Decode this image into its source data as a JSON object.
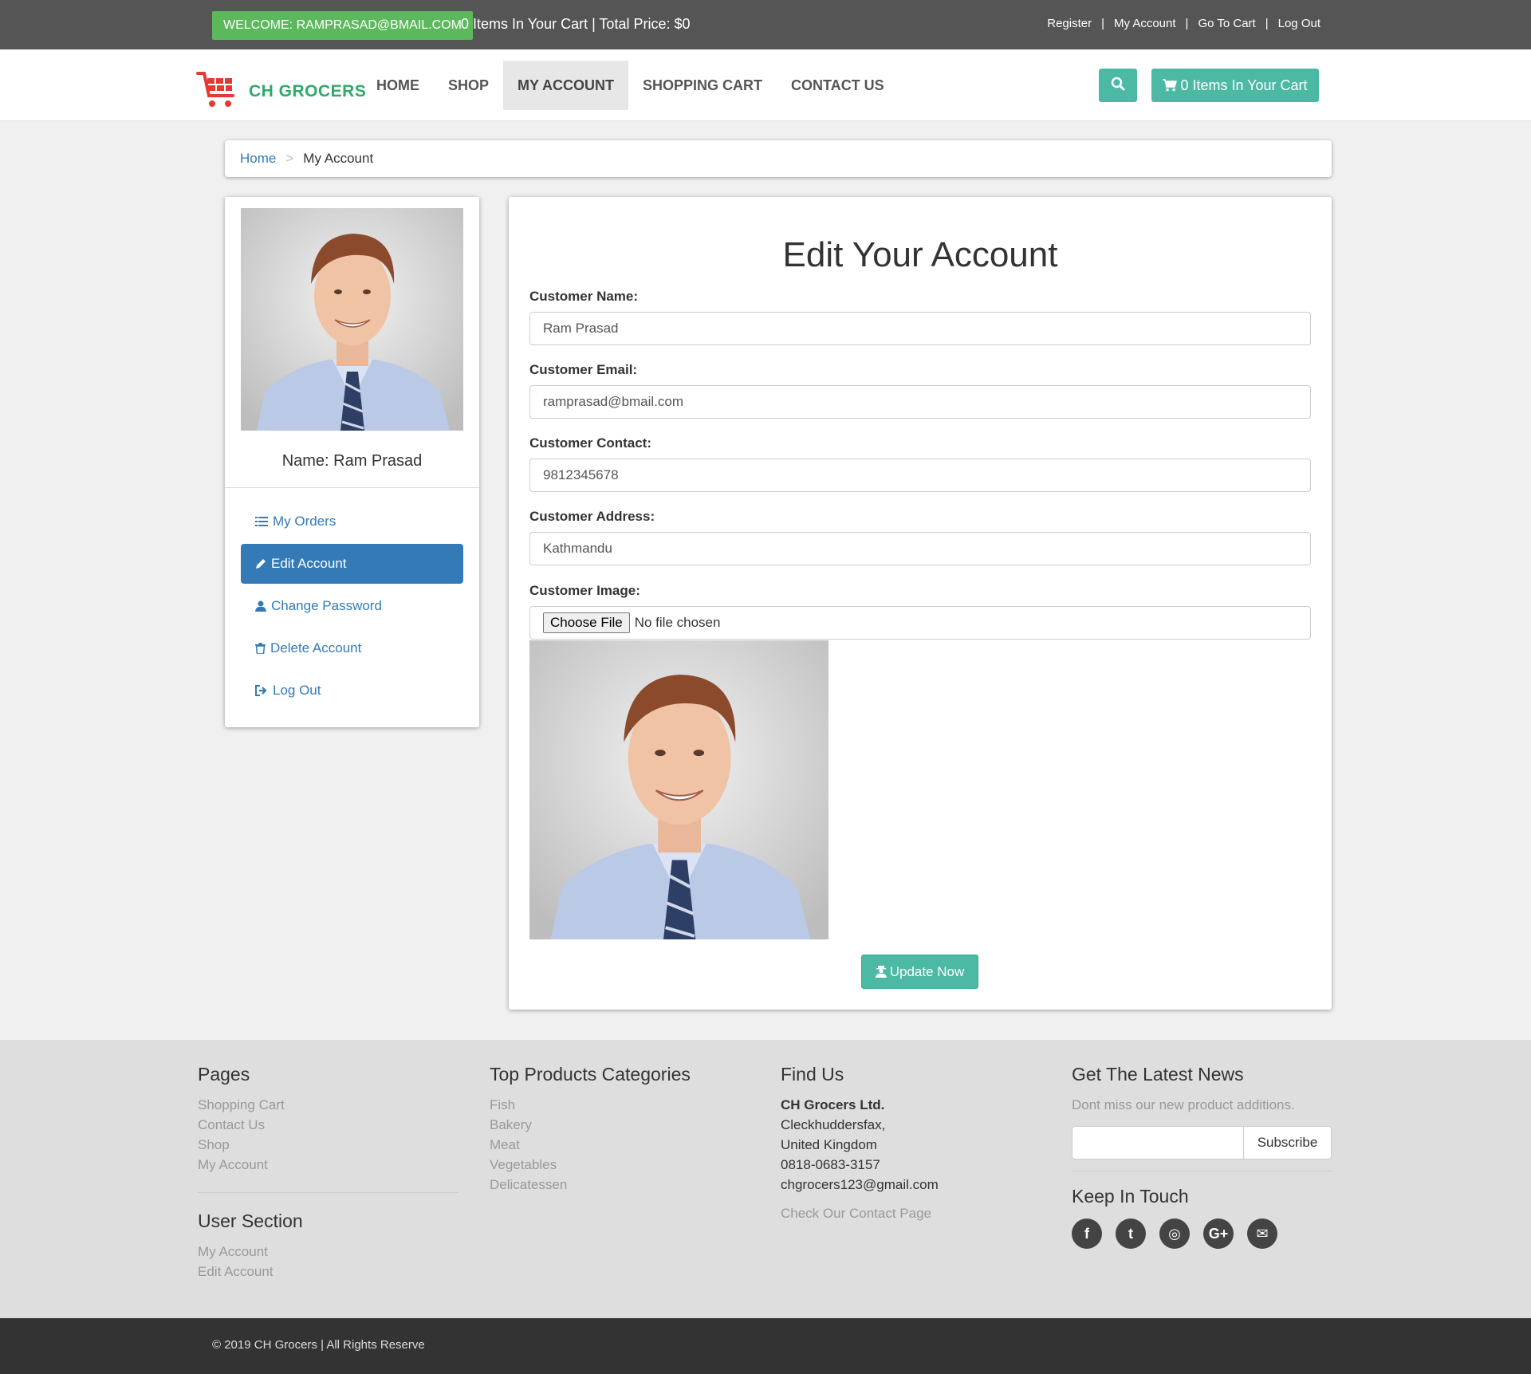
{
  "topbar": {
    "welcome": "WELCOME: RAMPRASAD@BMAIL.COM",
    "cart_info": "0 Items In Your Cart | Total Price: $0",
    "links": [
      "Register",
      "My Account",
      "Go To Cart",
      "Log Out"
    ],
    "separator": "|"
  },
  "brand": {
    "name": "CH GROCERS",
    "accent": "#2eaa6a",
    "cart_logo_color": "#e53935"
  },
  "nav": {
    "items": [
      "HOME",
      "SHOP",
      "MY ACCOUNT",
      "SHOPPING CART",
      "CONTACT US"
    ],
    "active": "MY ACCOUNT",
    "cart_button": "0 Items In Your Cart",
    "search_icon": "search-icon",
    "button_color": "#4cb9a5"
  },
  "breadcrumb": {
    "home": "Home",
    "separator": ">",
    "current": "My Account"
  },
  "sidebar": {
    "name": "Name: Ram Prasad",
    "menu": [
      {
        "label": "My Orders",
        "icon": "list-icon"
      },
      {
        "label": "Edit Account",
        "icon": "pencil-icon",
        "active": true
      },
      {
        "label": "Change Password",
        "icon": "user-icon"
      },
      {
        "label": "Delete Account",
        "icon": "trash-icon"
      },
      {
        "label": "Log Out",
        "icon": "sign-out-icon"
      }
    ],
    "active_color": "#337ab7"
  },
  "form": {
    "title": "Edit Your Account",
    "name_label": "Customer Name:",
    "name_value": "Ram Prasad",
    "email_label": "Customer Email:",
    "email_value": "ramprasad@bmail.com",
    "contact_label": "Customer Contact:",
    "contact_value": "9812345678",
    "address_label": "Customer Address:",
    "address_value": "Kathmandu",
    "image_label": "Customer Image:",
    "choose_file": "Choose File",
    "no_file": "No file chosen",
    "submit": "Update Now"
  },
  "footer": {
    "pages_title": "Pages",
    "pages_links": [
      "Shopping Cart",
      "Contact Us",
      "Shop",
      "My Account"
    ],
    "user_title": "User Section",
    "user_links": [
      "My Account",
      "Edit Account"
    ],
    "categories_title": "Top Products Categories",
    "categories": [
      "Fish",
      "Bakery",
      "Meat",
      "Vegetables",
      "Delicatessen"
    ],
    "find_title": "Find Us",
    "company": "CH Grocers Ltd.",
    "address_lines": [
      "Cleckhuddersfax,",
      "United Kingdom",
      "0818-0683-3157",
      "chgrocers123@gmail.com"
    ],
    "contact_link": "Check Our Contact Page",
    "news_title": "Get The Latest News",
    "news_text": "Dont miss our new product additions.",
    "subscribe": "Subscribe",
    "touch_title": "Keep In Touch",
    "social": [
      {
        "icon": "facebook-icon",
        "glyph": "f"
      },
      {
        "icon": "twitter-icon",
        "glyph": "t"
      },
      {
        "icon": "instagram-icon",
        "glyph": "◎"
      },
      {
        "icon": "google-plus-icon",
        "glyph": "G+"
      },
      {
        "icon": "envelope-icon",
        "glyph": "✉"
      }
    ]
  },
  "copyright": "© 2019 CH Grocers | All Rights Reserve"
}
